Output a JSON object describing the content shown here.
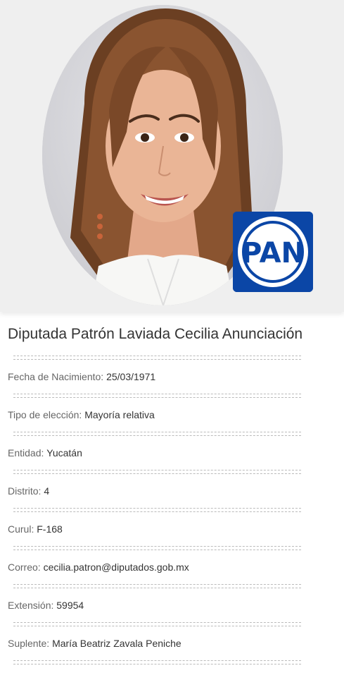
{
  "profile": {
    "photo_alt": "Retrato de la diputada",
    "party": {
      "name": "PAN",
      "brand_color": "#0b46a6",
      "icon": "pan-party-logo-icon"
    },
    "name": "Diputada Patrón Laviada Cecilia Anunciación",
    "fields": [
      {
        "label": "Fecha de Nacimiento: ",
        "value": "25/03/1971"
      },
      {
        "label": "Tipo de elección: ",
        "value": "Mayoría relativa"
      },
      {
        "label": "Entidad: ",
        "value": "Yucatán"
      },
      {
        "label": "Distrito: ",
        "value": "4"
      },
      {
        "label": "Curul: ",
        "value": "F-168"
      },
      {
        "label": "Correo: ",
        "value": "cecilia.patron@diputados.gob.mx"
      },
      {
        "label": "Extensión: ",
        "value": "59954"
      },
      {
        "label": "Suplente: ",
        "value": "María Beatriz Zavala Peniche"
      }
    ]
  }
}
